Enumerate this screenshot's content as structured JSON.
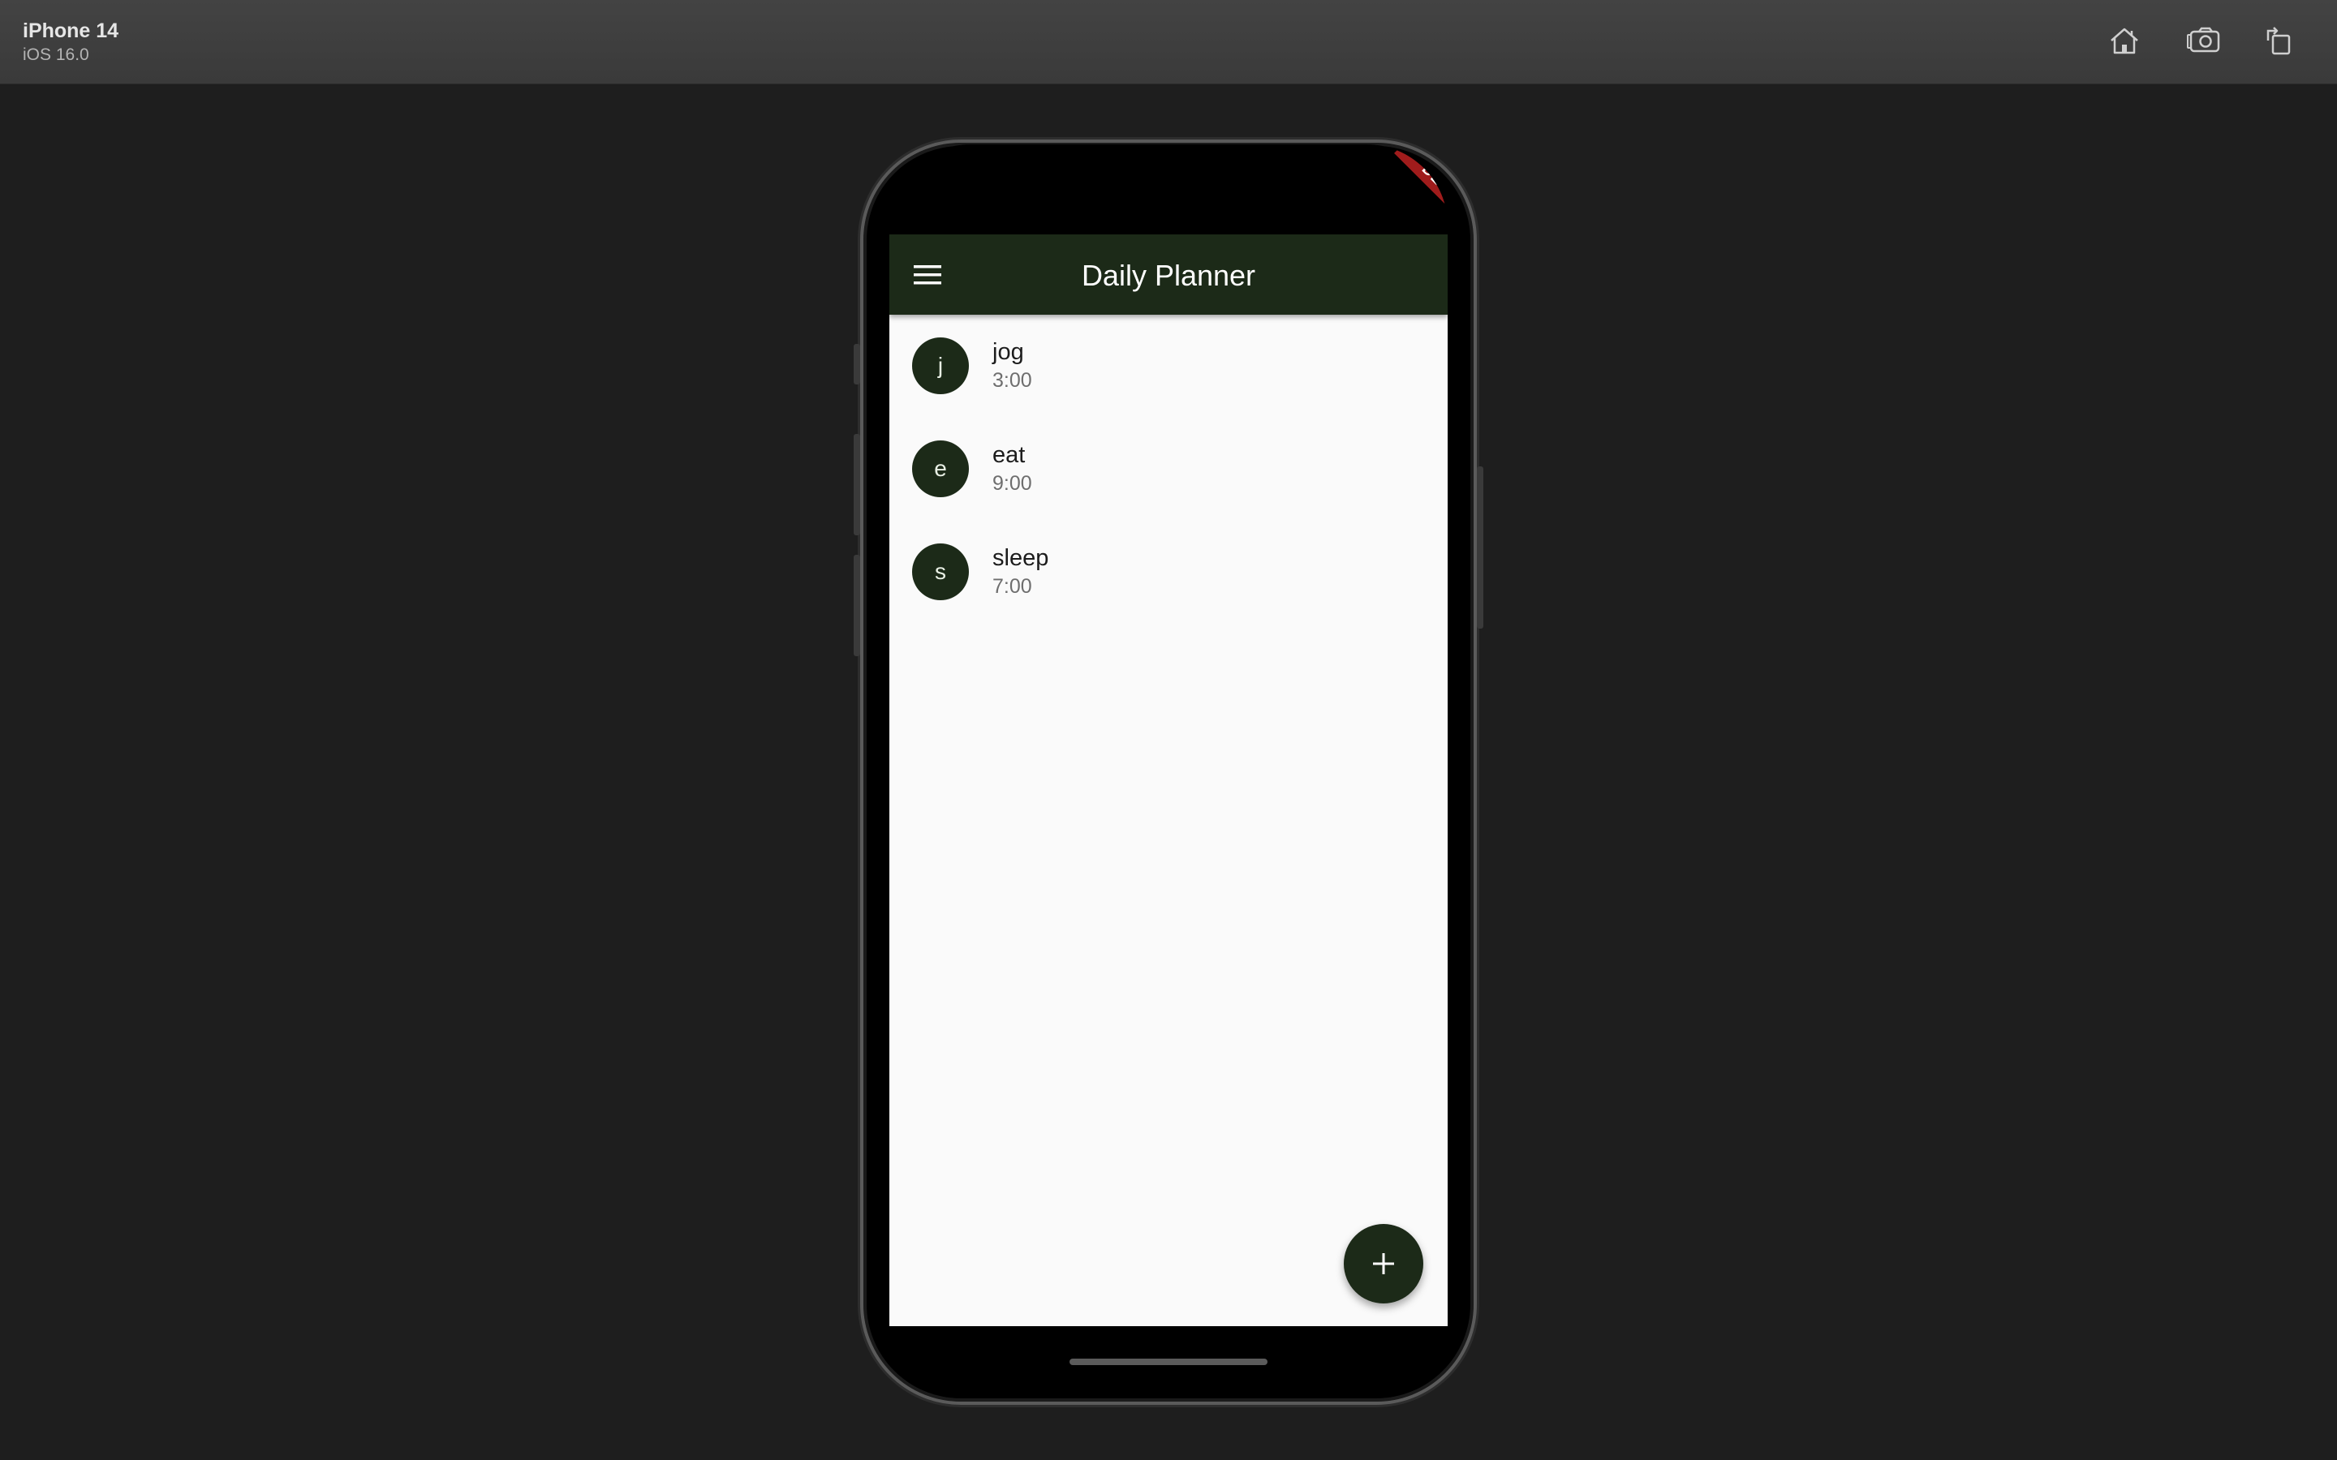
{
  "simulator": {
    "device_name": "iPhone 14",
    "os_version": "iOS 16.0",
    "toolbar_icons": [
      "home-icon",
      "screenshot-icon",
      "rotate-icon"
    ]
  },
  "app": {
    "title": "Daily Planner",
    "debug_banner": "DEBUG",
    "accent_color": "#1c2a18",
    "items": [
      {
        "avatar": "j",
        "title": "jog",
        "subtitle": "3:00"
      },
      {
        "avatar": "e",
        "title": "eat",
        "subtitle": "9:00"
      },
      {
        "avatar": "s",
        "title": "sleep",
        "subtitle": "7:00"
      }
    ],
    "fab_icon": "plus-icon"
  }
}
